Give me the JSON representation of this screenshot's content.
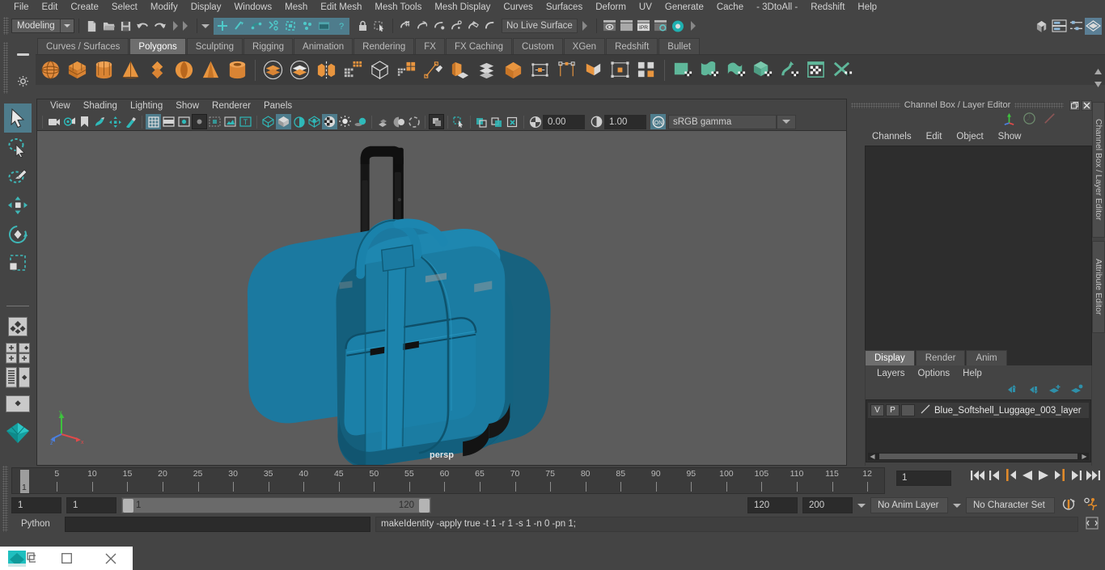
{
  "app": {
    "name": "Autodesk Maya"
  },
  "menubar": {
    "items": [
      "File",
      "Edit",
      "Create",
      "Select",
      "Modify",
      "Display",
      "Windows",
      "Mesh",
      "Edit Mesh",
      "Mesh Tools",
      "Mesh Display",
      "Curves",
      "Surfaces",
      "Deform",
      "UV",
      "Generate",
      "Cache",
      "- 3DtoAll -",
      "Redshift",
      "Help"
    ]
  },
  "statusline": {
    "menuset": "Modeling",
    "live_surface": "No Live Surface",
    "icons": [
      "new-scene-icon",
      "open-scene-icon",
      "save-scene-icon",
      "undo-icon",
      "redo-icon",
      "select-by-hierarchy-icon",
      "select-by-object-icon",
      "select-by-component-icon",
      "mask-vertex-icon",
      "mask-edge-icon",
      "mask-face-icon",
      "mask-uv-icon",
      "mask-help-icon",
      "lock-selection-icon",
      "highlight-selection-icon",
      "snap-grid-icon",
      "snap-curve-icon",
      "snap-point-icon",
      "snap-projected-center-icon",
      "snap-view-plane-icon",
      "make-live-icon",
      "render-view-icon",
      "render-region-icon",
      "ipr-render-icon",
      "render-settings-icon",
      "hypershade-icon",
      "editor-toggles-icon"
    ],
    "right_icons": [
      "show-hide-modeling-toolkit-icon",
      "show-hide-attribute-editor-icon",
      "show-hide-tool-settings-icon",
      "show-hide-channel-box-icon"
    ]
  },
  "shelf": {
    "tabs": [
      "Curves / Surfaces",
      "Polygons",
      "Sculpting",
      "Rigging",
      "Animation",
      "Rendering",
      "FX",
      "FX Caching",
      "Custom",
      "XGen",
      "Redshift",
      "Bullet"
    ],
    "active_tab": "Polygons",
    "buttons": [
      "poly-sphere-icon",
      "poly-cube-icon",
      "poly-cylinder-icon",
      "poly-cone-icon",
      "poly-torus-icon",
      "poly-prism-icon",
      "poly-pyramid-icon",
      "poly-pipe-icon",
      "poly-booleans-union-icon",
      "poly-booleans-difference-icon",
      "poly-mirror-icon",
      "poly-combine-icon",
      "poly-smooth-icon",
      "poly-reduce-icon",
      "poly-create-tool-icon",
      "poly-extrude-icon",
      "poly-bevel-icon",
      "poly-bridge-icon",
      "poly-append-icon",
      "poly-quad-draw-icon",
      "poly-multicut-icon",
      "poly-target-weld-icon",
      "poly-sculpt-icon",
      "uv-planar-icon",
      "uv-cylindrical-icon",
      "uv-spherical-icon",
      "uv-automatic-icon",
      "uv-contour-stretch-icon",
      "uv-editor-icon",
      "uv-unfold-icon"
    ]
  },
  "toolbox": {
    "tools": [
      "select-tool-icon",
      "lasso-select-tool-icon",
      "paint-select-tool-icon",
      "move-tool-icon",
      "rotate-tool-icon",
      "scale-tool-icon"
    ],
    "layouts": [
      "single-perspective-layout-icon",
      "four-view-layout-icon",
      "persp-outliner-layout-icon",
      "persp-graph-editor-layout-icon",
      "hypershade-layout-icon"
    ],
    "active_tool": "select-tool-icon"
  },
  "viewport": {
    "menus": [
      "View",
      "Shading",
      "Lighting",
      "Show",
      "Renderer",
      "Panels"
    ],
    "camera_label": "persp",
    "exposure": "0.00",
    "gamma": "1.00",
    "color_management": "sRGB gamma",
    "toolbar_icons": [
      "select-camera-icon",
      "camera-attributes-icon",
      "bookmark-icon",
      "image-plane-icon",
      "2d-pan-zoom-icon",
      "grease-pencil-icon",
      "grid-toggle-icon",
      "film-gate-icon",
      "resolution-gate-icon",
      "gate-mask-icon",
      "film-origin-icon",
      "safe-action-icon",
      "title-safe-icon",
      "wireframe-icon",
      "smooth-shade-all-icon",
      "shaded-wireframe-icon",
      "use-default-material-icon",
      "textured-icon",
      "use-all-lights-icon",
      "shadows-icon",
      "screen-space-ao-icon",
      "motion-blur-icon",
      "multisample-icon",
      "depth-of-field-icon",
      "isolate-select-icon",
      "xray-icon",
      "xray-joints-icon",
      "xray-active-components-icon",
      "exposure-icon",
      "contrast-icon",
      "view-transform-toggle-icon"
    ],
    "model": {
      "name": "Blue Softshell Luggage",
      "body_color": "#1a6e96",
      "handle_color": "#1c1c1c",
      "background": "#5c5c5c"
    }
  },
  "channel_box": {
    "panel_title": "Channel Box / Layer Editor",
    "menus": [
      "Channels",
      "Edit",
      "Object",
      "Show"
    ],
    "header_icons": [
      "channel-box-icon",
      "attribute-editor-icon",
      "tool-settings-icon"
    ],
    "window_buttons": [
      "undock-icon",
      "close-icon"
    ]
  },
  "layer_editor": {
    "tabs": [
      "Display",
      "Render",
      "Anim"
    ],
    "active_tab": "Display",
    "menus": [
      "Layers",
      "Options",
      "Help"
    ],
    "buttons": [
      "move-layer-up-icon",
      "move-layer-down-icon",
      "create-new-layer-icon",
      "create-layer-from-selected-icon"
    ],
    "layers": [
      {
        "visibility": "V",
        "playback": "P",
        "type": "",
        "name": "Blue_Softshell_Luggage_003_layer"
      }
    ]
  },
  "side_tabs": [
    "Channel Box / Layer Editor",
    "Attribute Editor"
  ],
  "timeline": {
    "tick_labels": [
      "5",
      "10",
      "15",
      "20",
      "25",
      "30",
      "35",
      "40",
      "45",
      "50",
      "55",
      "60",
      "65",
      "70",
      "75",
      "80",
      "85",
      "90",
      "95",
      "100",
      "105",
      "110",
      "115",
      "12"
    ],
    "current_frame": "1",
    "current_frame_field": "1",
    "playback_buttons": [
      "go-to-start-icon",
      "step-back-frame-icon",
      "step-back-key-icon",
      "play-backwards-icon",
      "play-forwards-icon",
      "step-forward-key-icon",
      "step-forward-frame-icon",
      "go-to-end-icon"
    ]
  },
  "range": {
    "anim_start": "1",
    "range_start": "1",
    "bar_start": "1",
    "bar_end": "120",
    "range_end": "120",
    "anim_end": "200",
    "anim_layer": "No Anim Layer",
    "character_set": "No Character Set",
    "right_icons": [
      "auto-key-icon",
      "animation-preferences-icon"
    ]
  },
  "command_line": {
    "language": "Python",
    "input_value": "",
    "output": "makeIdentity -apply true -t 1 -r 1 -s 1 -n 0 -pn 1;",
    "script-editor-icon": "script-editor-icon"
  },
  "taskbar": {
    "items": [
      "app-thumbnail-icon",
      "restore-window-icon",
      "maximize-window-icon",
      "close-window-icon"
    ]
  }
}
